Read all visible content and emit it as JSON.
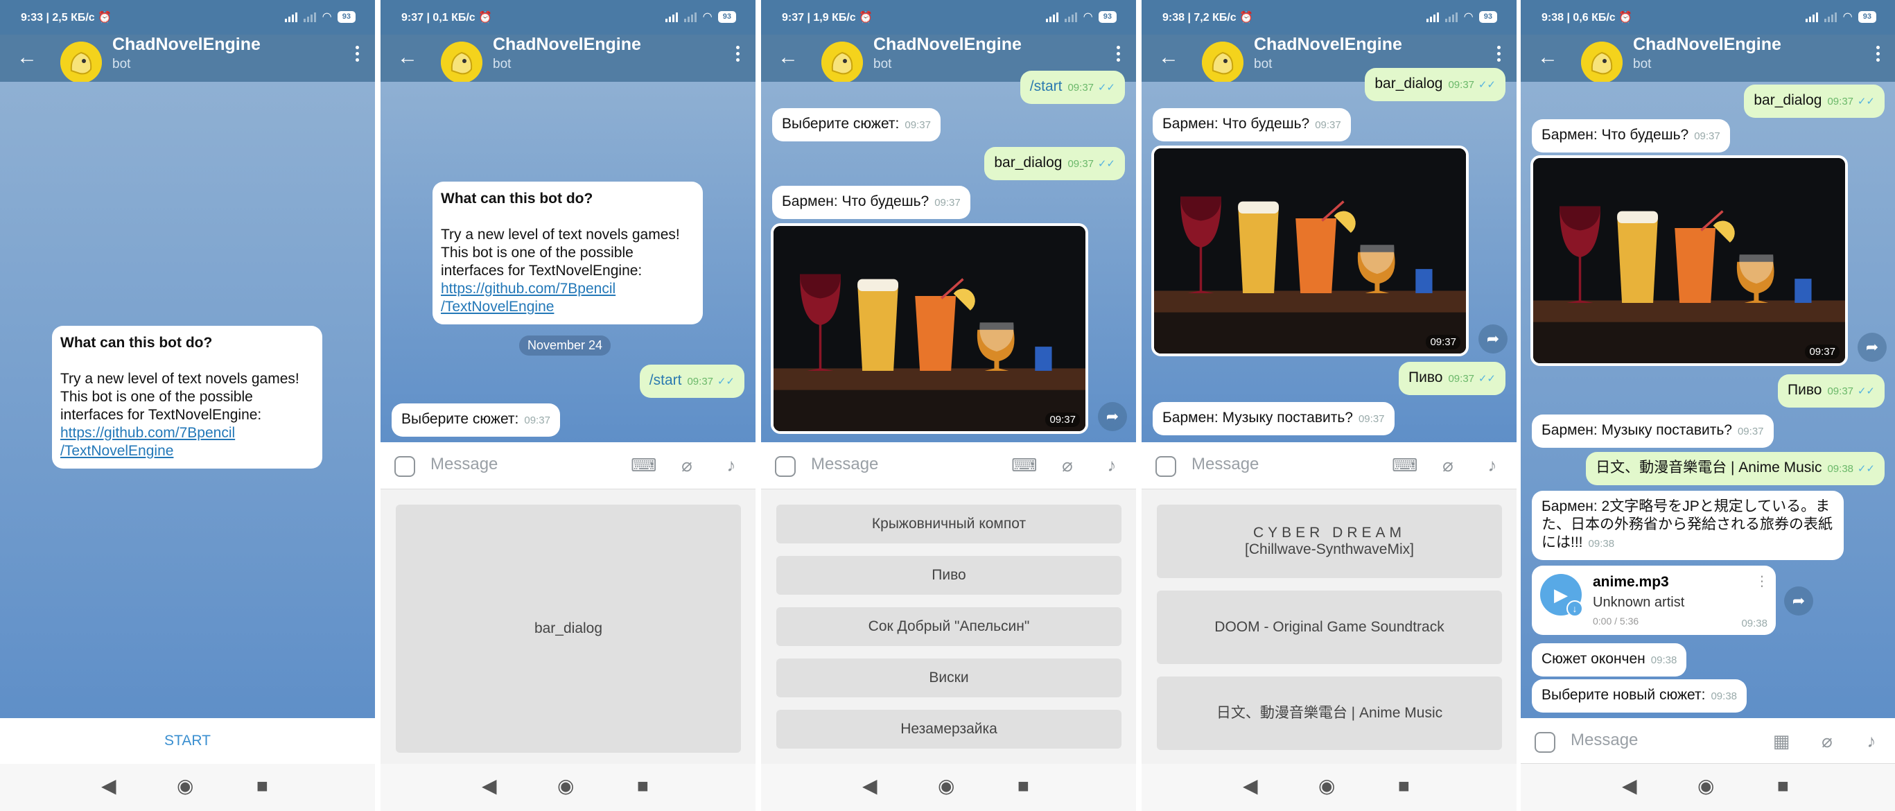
{
  "phones": [
    {
      "status": "9:33 | 2,5 КБ/с ⏰",
      "battery": "93"
    },
    {
      "status": "9:37 | 0,1 КБ/с ⏰",
      "battery": "93"
    },
    {
      "status": "9:37 | 1,9 КБ/с ⏰",
      "battery": "93"
    },
    {
      "status": "9:38 | 7,2 КБ/с ⏰",
      "battery": "93"
    },
    {
      "status": "9:38 | 0,6 КБ/с ⏰",
      "battery": "93"
    }
  ],
  "bot": {
    "name": "ChadNovelEngine",
    "sub": "bot"
  },
  "info": {
    "title": "What can this bot do?",
    "text": "Try a new level of text novels games! This bot is one of the possible interfaces for TextNovelEngine:",
    "link1": "https://github.com/7Bpencil",
    "link2": "/TextNovelEngine"
  },
  "start_label": "START",
  "input_placeholder": "Message",
  "date_label": "November 24",
  "msgs": {
    "start_cmd": "/start",
    "choose": "Выберите сюжет:",
    "bar_dialog": "bar_dialog",
    "barmen_what": "Бармен: Что будешь?",
    "pivo": "Пиво",
    "barmen_music": "Бармен: Музыку поставить?",
    "anime_music": "日文、動漫音樂電台 | Anime Music",
    "barmen_jp": "Бармен: 2文字略号をJPと規定している。また、日本の外務省から発給される旅券の表紙には!!!",
    "story_end": "Сюжет окончен",
    "choose_new": "Выберите новый сюжет:"
  },
  "times": {
    "t0937": "09:37",
    "t0938": "09:38"
  },
  "audio": {
    "title": "anime.mp3",
    "artist": "Unknown artist",
    "progress": "0:00 / 5:36"
  },
  "kb2": [
    "bar_dialog"
  ],
  "kb3": [
    "Крыжовничный компот",
    "Пиво",
    "Сок Добрый \"Апельсин\"",
    "Виски",
    "Незамерзайка"
  ],
  "kb4": [
    {
      "l1": "CYBER DREAM",
      "l2": "[Chillwave-SynthwaveMix]"
    },
    {
      "l1": "DOOM - Original Game Soundtrack",
      "l2": ""
    },
    {
      "l1": "日文、動漫音樂電台 | Anime Music",
      "l2": ""
    }
  ]
}
